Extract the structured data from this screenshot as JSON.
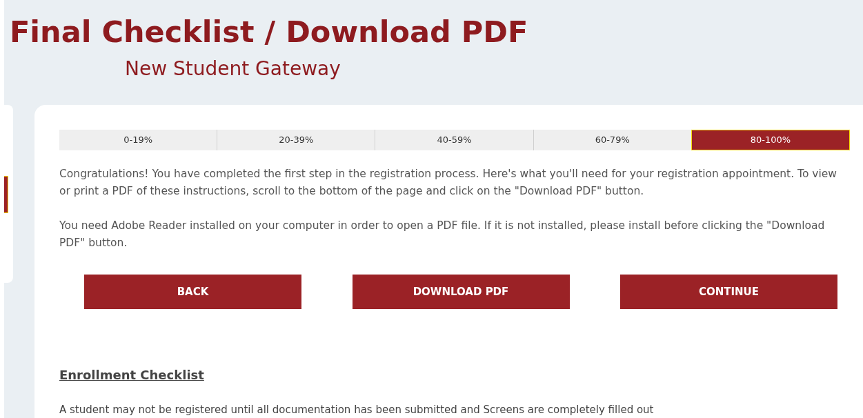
{
  "header": {
    "title": "Final Checklist / Download PDF",
    "subtitle": "New Student Gateway"
  },
  "side_tab": {
    "selected": true
  },
  "progress": [
    {
      "label": "0-19%",
      "selected": false
    },
    {
      "label": "20-39%",
      "selected": false
    },
    {
      "label": "40-59%",
      "selected": false
    },
    {
      "label": "60-79%",
      "selected": false
    },
    {
      "label": "80-100%",
      "selected": true
    }
  ],
  "paragraphs": [
    "Congratulations! You have completed the first step in the registration process. Here's what you'll need for your registration appointment. To view or print a PDF of these instructions, scroll to the bottom of the page and click on the \"Download PDF\" button.",
    "You need Adobe Reader installed on your computer in order to open a PDF file. If it is not installed, please install before clicking the \"Download PDF\" button."
  ],
  "buttons": [
    "BACK",
    "DOWNLOAD PDF",
    "CONTINUE"
  ],
  "section": {
    "heading": "Enrollment Checklist",
    "text": "A student may not be registered until all documentation has been submitted and Screens are completely filled out"
  }
}
